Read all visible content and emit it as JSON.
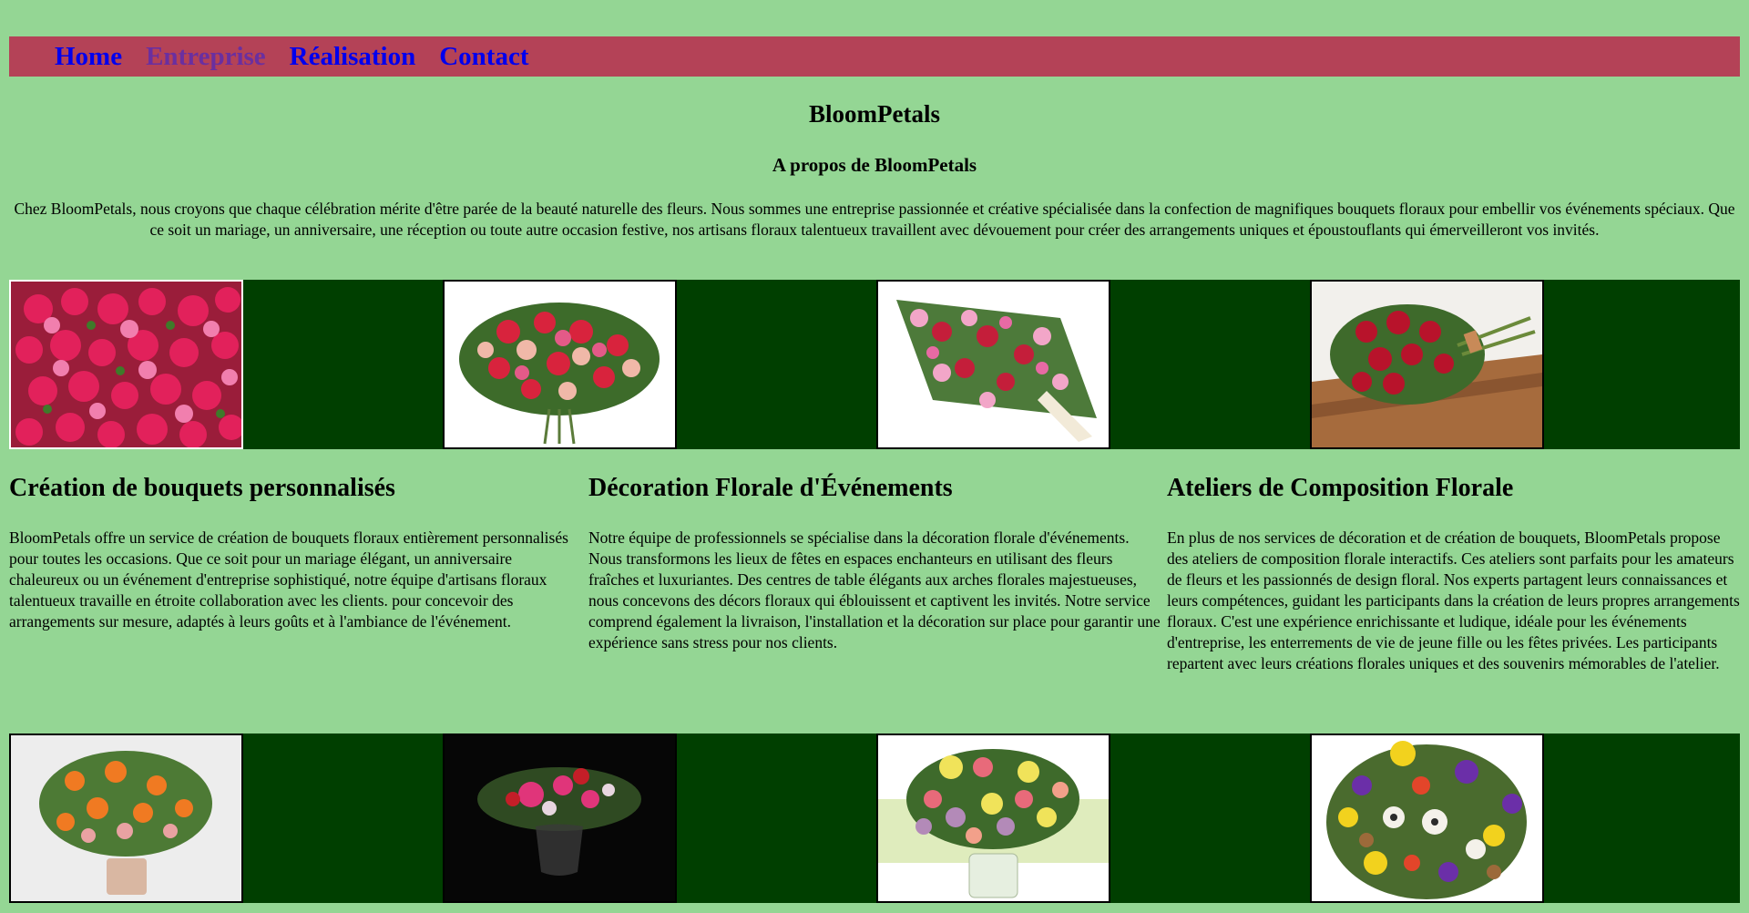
{
  "nav": {
    "items": [
      {
        "label": "Home",
        "state": "link"
      },
      {
        "label": "Entreprise",
        "state": "visited"
      },
      {
        "label": "Réalisation",
        "state": "link"
      },
      {
        "label": "Contact",
        "state": "link"
      }
    ]
  },
  "header": {
    "title": "BloomPetals",
    "about_title": "A propos de BloomPetals",
    "about_text": "Chez BloomPetals, nous croyons que chaque célébration mérite d'être parée de la beauté naturelle des fleurs. Nous sommes une entreprise passionnée et créative spécialisée dans la confection de magnifiques bouquets floraux pour embellir vos événements spéciaux. Que ce soit un mariage, un anniversaire, une réception ou toute autre occasion festive, nos artisans floraux talentueux travaillent avec dévouement pour créer des arrangements uniques et époustouflants qui émerveilleront vos invités."
  },
  "services": [
    {
      "title": "Création de bouquets personnalisés",
      "text": "BloomPetals offre un service de création de bouquets floraux entièrement personnalisés pour toutes les occasions. Que ce soit pour un mariage élégant, un anniversaire chaleureux ou un événement d'entreprise sophistiqué, notre équipe d'artisans floraux talentueux travaille en étroite collaboration avec les clients. pour concevoir des arrangements sur mesure, adaptés à leurs goûts et à l'ambiance de l'événement."
    },
    {
      "title": "Décoration Florale d'Événements",
      "text": "Notre équipe de professionnels se spécialise dans la décoration florale d'événements. Nous transformons les lieux de fêtes en espaces enchanteurs en utilisant des fleurs fraîches et luxuriantes. Des centres de table élégants aux arches florales majestueuses, nous concevons des décors floraux qui éblouissent et captivent les invités. Notre service comprend également la livraison, l'installation et la décoration sur place pour garantir une expérience sans stress pour nos clients."
    },
    {
      "title": "Ateliers de Composition Florale",
      "text": "En plus de nos services de décoration et de création de bouquets, BloomPetals propose des ateliers de composition florale interactifs. Ces ateliers sont parfaits pour les amateurs de fleurs et les passionnés de design floral. Nos experts partagent leurs connaissances et leurs compétences, guidant les participants dans la création de leurs propres arrangements floraux. C'est une expérience enrichissante et ludique, idéale pour les événements d'entreprise, les enterrements de vie de jeune fille ou les fêtes privées. Les participants repartent avec leurs créations florales uniques et des souvenirs mémorables de l'atelier."
    }
  ],
  "colors": {
    "page_bg": "#94d694",
    "nav_bg": "#b44257",
    "link": "#0000ee",
    "visited": "#6a2fa0",
    "gallery_bg": "#003f00"
  }
}
